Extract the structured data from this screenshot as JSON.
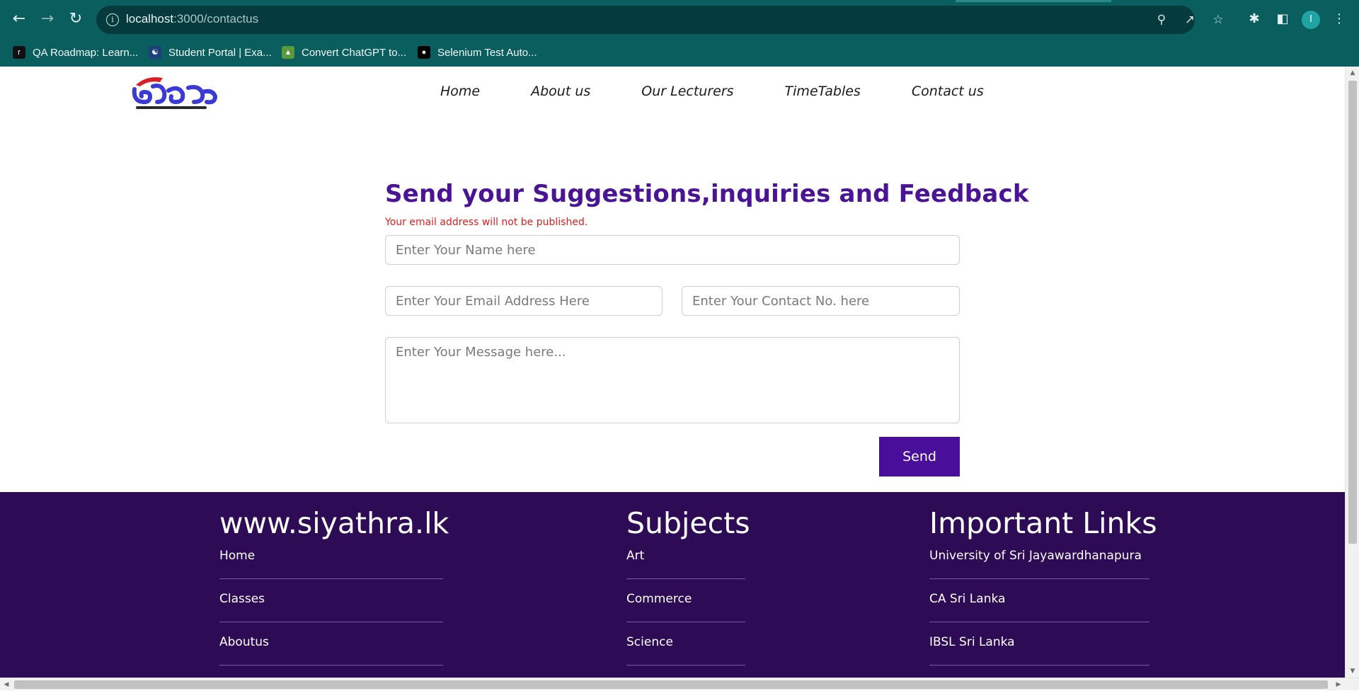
{
  "browser": {
    "url_host": "localhost",
    "url_path": ":3000/contactus",
    "profile_initial": "I",
    "bookmarks": [
      {
        "label": "QA Roadmap: Learn...",
        "icon": "roadmap-icon"
      },
      {
        "label": "Student Portal | Exa...",
        "icon": "portal-icon"
      },
      {
        "label": "Convert ChatGPT to...",
        "icon": "convert-icon"
      },
      {
        "label": "Selenium Test Auto...",
        "icon": "video-icon"
      }
    ]
  },
  "site": {
    "nav": [
      "Home",
      "About us",
      "Our Lecturers",
      "TimeTables",
      "Contact us"
    ]
  },
  "form": {
    "title": "Send your Suggestions,inquiries and Feedback",
    "note": "Your email address will not be published.",
    "name_placeholder": "Enter Your Name here",
    "email_placeholder": "Enter Your Email Address Here",
    "contact_placeholder": "Enter Your Contact No. here",
    "message_placeholder": "Enter Your Message here...",
    "send_label": "Send"
  },
  "footer": {
    "col1": {
      "title": "www.siyathra.lk",
      "links": [
        "Home",
        "Classes",
        "Aboutus"
      ]
    },
    "col2": {
      "title": "Subjects",
      "links": [
        "Art",
        "Commerce",
        "Science"
      ]
    },
    "col3": {
      "title": "Important Links",
      "links": [
        "University of Sri Jayawardhanapura",
        "CA Sri Lanka",
        "IBSL Sri Lanka"
      ]
    }
  },
  "colors": {
    "chrome": "#0b5e5e",
    "title": "#4a1594",
    "note": "#e02020",
    "send_button": "#4a0f9a",
    "footer": "#2d0b55"
  }
}
